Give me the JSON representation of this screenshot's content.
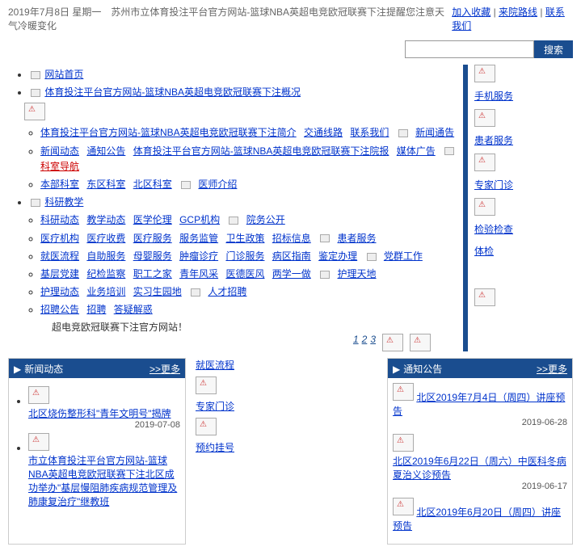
{
  "header": {
    "date_line": "2019年7月8日 星期一　苏州市立体育投注平台官方网站-篮球NBA英超电竞欧冠联赛下注提醒您注意天气冷暖变化",
    "favorite": "加入收藏",
    "route": "来院路线",
    "contact": "联系我们"
  },
  "search": {
    "placeholder": "",
    "button": "搜索"
  },
  "nav": {
    "home": "网站首页",
    "about": "体育投注平台官方网站-篮球NBA英超电竞欧冠联赛下注概况",
    "about_sub": {
      "a1": "体育投注平台官方网站-篮球NBA英超电竞欧冠联赛下注简介",
      "a2": "交通线路",
      "a3": "联系我们",
      "a4": "新闻通告"
    },
    "news": {
      "n1": "新闻动态",
      "n2": "通知公告",
      "n3": "体育投注平台官方网站-篮球NBA英超电竞欧冠联赛下注院报",
      "n4": "媒体广告",
      "n5": "科室导航"
    },
    "dept": {
      "d1": "本部科室",
      "d2": "东区科室",
      "d3": "北区科室",
      "d4": "医师介绍"
    },
    "edu": "科研教学",
    "edu_sub": {
      "e1": "科研动态",
      "e2": "教学动态",
      "e3": "医学伦理",
      "e4": "GCP机构",
      "e5": "院务公开"
    },
    "svc": {
      "s1": "医疗机构",
      "s2": "医疗收费",
      "s3": "医疗服务",
      "s4": "服务监管",
      "s5": "卫生政策",
      "s6": "招标信息",
      "s7": "患者服务"
    },
    "guide": {
      "g1": "就医流程",
      "g2": "自助服务",
      "g3": "母婴服务",
      "g4": "肿瘤诊疗",
      "g5": "门诊服务",
      "g6": "病区指南",
      "g7": "鉴定办理",
      "g8": "党群工作"
    },
    "party": {
      "p1": "基层党建",
      "p2": "纪检监察",
      "p3": "职工之家",
      "p4": "青年风采",
      "p5": "医德医风",
      "p6": "两学一做",
      "p7": "护理天地"
    },
    "nurse": {
      "u1": "护理动态",
      "u2": "业务培训",
      "u3": "实习生园地",
      "u4": "人才招聘"
    },
    "hr": {
      "h1": "招聘公告",
      "h2": "招聘",
      "h3": "答疑解惑"
    },
    "site_note": "超电竞欧冠联赛下注官方网站！"
  },
  "side": {
    "s1": "手机服务",
    "s2": "患者服务",
    "s3": "专家门诊",
    "s4": "检验检查",
    "s5": "体检"
  },
  "pagers": {
    "p1": "1",
    "p2": "2",
    "p3": "3"
  },
  "panels": {
    "news": {
      "title": "新闻动态",
      "more": ">>更多",
      "items": [
        {
          "t": "北区烧伤整形科\"青年文明号\"揭牌",
          "d": "2019-07-08"
        },
        {
          "t": "市立体育投注平台官方网站-篮球NBA英超电竞欧冠联赛下注北区成功举办\"基层慢阻肺疾病规范管理及肺康复治疗\"继教班",
          "d": ""
        }
      ]
    },
    "midlinks": {
      "l1": "就医流程",
      "l2": "专家门诊",
      "l3": "预约挂号"
    },
    "notice": {
      "title": "通知公告",
      "more": ">>更多",
      "items": [
        {
          "t": "北区2019年7月4日（周四）讲座预告",
          "d": "2019-06-28"
        },
        {
          "t": "北区2019年6月22日（周六）中医科冬病夏治义诊预告",
          "d": "2019-06-17"
        },
        {
          "t": "北区2019年6月20日（周四）讲座预告",
          "d": ""
        }
      ]
    }
  }
}
